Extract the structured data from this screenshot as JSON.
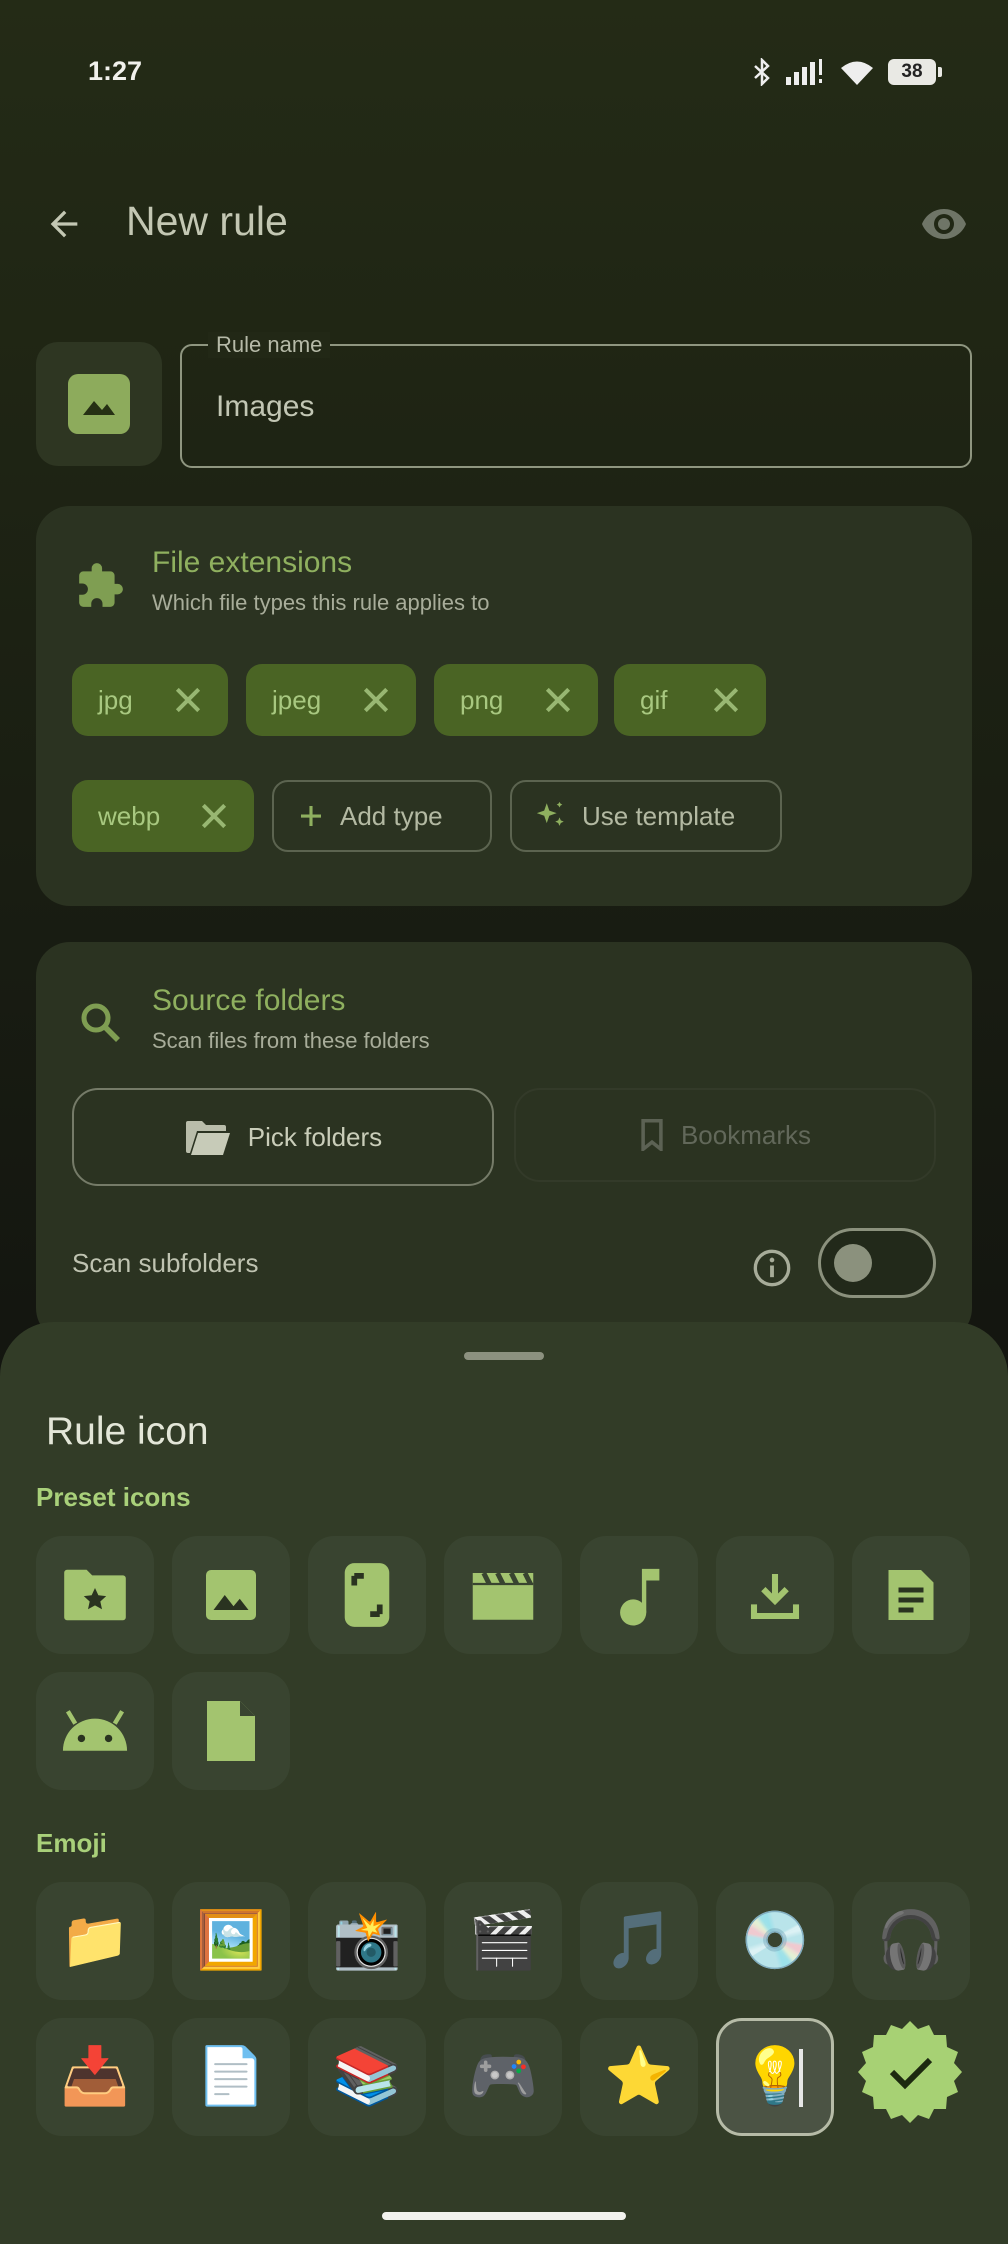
{
  "status": {
    "time": "1:27",
    "battery": "38"
  },
  "header": {
    "title": "New rule"
  },
  "rule_name": {
    "label": "Rule name",
    "value": "Images"
  },
  "extensions": {
    "title": "File extensions",
    "subtitle": "Which file types this rule applies to",
    "chips": [
      "jpg",
      "jpeg",
      "png",
      "gif",
      "webp"
    ],
    "add_label": "Add type",
    "template_label": "Use template"
  },
  "source": {
    "title": "Source folders",
    "subtitle": "Scan files from these folders",
    "pick_label": "Pick folders",
    "bookmarks_label": "Bookmarks",
    "scan_label": "Scan subfolders",
    "scan_enabled": false
  },
  "sheet": {
    "title": "Rule icon",
    "preset_label": "Preset icons",
    "emoji_label": "Emoji",
    "preset_icons": [
      "folder-star",
      "image",
      "phone-screenshot",
      "movie",
      "music-note",
      "download",
      "document",
      "android",
      "file"
    ],
    "emoji_row1": [
      "📁",
      "🖼️",
      "📸",
      "🎬",
      "🎵",
      "💿",
      "🎧"
    ],
    "emoji_row2": [
      "📥",
      "📄",
      "📚",
      "🎮",
      "⭐",
      "💡"
    ],
    "selected_emoji": "💡"
  },
  "colors": {
    "accent": "#a9d07a",
    "chip_bg": "#4a6424",
    "sheet_bg": "#323c27"
  }
}
